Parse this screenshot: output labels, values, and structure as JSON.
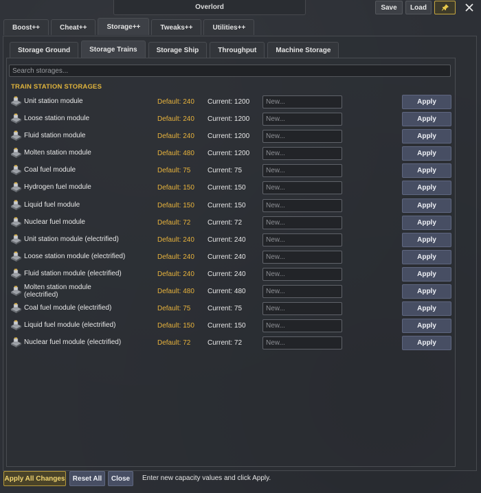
{
  "window": {
    "title": "Overlord",
    "save": "Save",
    "load": "Load",
    "pin_icon": "pin-icon",
    "close_icon": "close-icon"
  },
  "main_tabs": [
    {
      "label": "Boost++"
    },
    {
      "label": "Cheat++"
    },
    {
      "label": "Storage++",
      "active": true
    },
    {
      "label": "Tweaks++"
    },
    {
      "label": "Utilities++"
    }
  ],
  "sub_tabs": [
    {
      "label": "Storage Ground"
    },
    {
      "label": "Storage Trains",
      "active": true
    },
    {
      "label": "Storage Ship"
    },
    {
      "label": "Throughput"
    },
    {
      "label": "Machine Storage"
    }
  ],
  "search": {
    "placeholder": "Search storages..."
  },
  "section_title": "TRAIN STATION STORAGES",
  "input_placeholder": "New...",
  "apply_label": "Apply",
  "rows": [
    {
      "name": "Unit station module",
      "default": "Default: 240",
      "current": "Current: 1200"
    },
    {
      "name": "Loose station module",
      "default": "Default: 240",
      "current": "Current: 1200"
    },
    {
      "name": "Fluid station module",
      "default": "Default: 240",
      "current": "Current: 1200"
    },
    {
      "name": "Molten station module",
      "default": "Default: 480",
      "current": "Current: 1200"
    },
    {
      "name": "Coal fuel module",
      "default": "Default: 75",
      "current": "Current: 75"
    },
    {
      "name": "Hydrogen fuel module",
      "default": "Default: 150",
      "current": "Current: 150"
    },
    {
      "name": "Liquid fuel module",
      "default": "Default: 150",
      "current": "Current: 150"
    },
    {
      "name": "Nuclear fuel module",
      "default": "Default: 72",
      "current": "Current: 72"
    },
    {
      "name": "Unit station module (electrified)",
      "default": "Default: 240",
      "current": "Current: 240"
    },
    {
      "name": "Loose station module (electrified)",
      "default": "Default: 240",
      "current": "Current: 240"
    },
    {
      "name": "Fluid station module (electrified)",
      "default": "Default: 240",
      "current": "Current: 240"
    },
    {
      "name": "Molten station module (electrified)",
      "default": "Default: 480",
      "current": "Current: 480"
    },
    {
      "name": "Coal fuel module (electrified)",
      "default": "Default: 75",
      "current": "Current: 75"
    },
    {
      "name": "Liquid fuel module (electrified)",
      "default": "Default: 150",
      "current": "Current: 150"
    },
    {
      "name": "Nuclear fuel module (electrified)",
      "default": "Default: 72",
      "current": "Current: 72"
    }
  ],
  "footer": {
    "apply_all": "Apply All Changes",
    "reset_all": "Reset All",
    "close": "Close",
    "hint": "Enter new capacity values and click Apply."
  }
}
